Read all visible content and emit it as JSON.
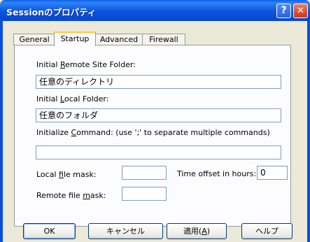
{
  "window": {
    "title": "Sessionのプロパティ"
  },
  "title_buttons": {
    "help": "?",
    "close": "✕"
  },
  "tabs": [
    {
      "label": "General"
    },
    {
      "label": "Startup"
    },
    {
      "label": "Advanced"
    },
    {
      "label": "Firewall"
    }
  ],
  "startup": {
    "remote_folder": {
      "label_pre": "Initial ",
      "label_key": "R",
      "label_post": "emote Site Folder:",
      "value": "任意のディレクトリ"
    },
    "local_folder": {
      "label_pre": "Initial ",
      "label_key": "L",
      "label_post": "ocal Folder:",
      "value": "任意のフォルダ"
    },
    "init_command": {
      "label_pre": "Initialize ",
      "label_key": "C",
      "label_post": "ommand: (use ';' to separate multiple commands)",
      "value": ""
    },
    "local_mask": {
      "label_pre": "Local ",
      "label_key": "f",
      "label_post": "ile mask:",
      "value": ""
    },
    "time_offset": {
      "label": "Time offset in hours:",
      "value": "0"
    },
    "remote_mask": {
      "label_pre": "Remote file ",
      "label_key": "m",
      "label_post": "ask:",
      "value": ""
    }
  },
  "buttons": {
    "ok": "OK",
    "cancel": "キャンセル",
    "apply_pre": "適用(",
    "apply_key": "A",
    "apply_post": ")",
    "help": "ヘルプ"
  }
}
